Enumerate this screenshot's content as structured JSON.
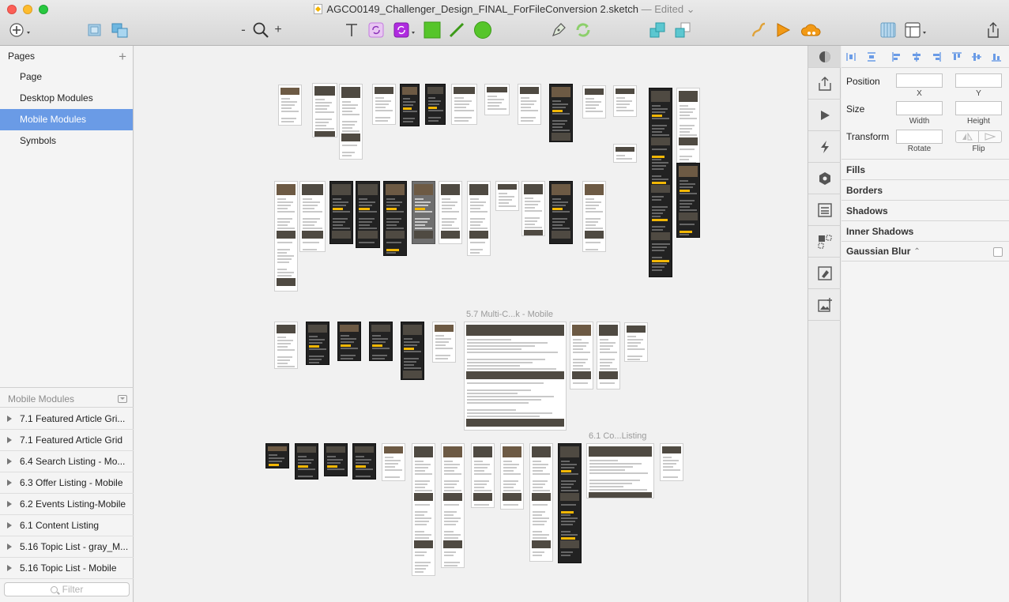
{
  "window": {
    "title": "AGCO0149_Challenger_Design_FINAL_ForFileConversion 2.sketch",
    "status": " — Edited"
  },
  "toolbar": {
    "zoom_minus": "-",
    "zoom_plus": "+"
  },
  "pages": {
    "header": "Pages",
    "add": "+",
    "items": [
      {
        "label": "Page"
      },
      {
        "label": "Desktop Modules"
      },
      {
        "label": "Mobile Modules",
        "selected": true
      },
      {
        "label": "Symbols"
      }
    ]
  },
  "layers": {
    "header": "Mobile Modules",
    "items": [
      {
        "label": "7.1 Featured Article Gri..."
      },
      {
        "label": "7.1 Featured Article Grid"
      },
      {
        "label": "6.4 Search Listing - Mo..."
      },
      {
        "label": "6.3 Offer Listing - Mobile"
      },
      {
        "label": "6.2 Events Listing-Mobile"
      },
      {
        "label": "6.1 Content Listing"
      },
      {
        "label": "5.16 Topic List - gray_M..."
      },
      {
        "label": "5.16 Topic List - Mobile"
      }
    ],
    "filter_placeholder": "Filter"
  },
  "canvas": {
    "labels": {
      "multi": "5.7 Multi-C...k - Mobile",
      "content": "6.1 Co...Listing"
    }
  },
  "inspector": {
    "position": "Position",
    "x": "X",
    "y": "Y",
    "size": "Size",
    "width": "Width",
    "height": "Height",
    "transform": "Transform",
    "rotate": "Rotate",
    "flip": "Flip",
    "sections": [
      "Fills",
      "Borders",
      "Shadows",
      "Inner Shadows",
      "Gaussian Blur"
    ],
    "blur_chevron": "⌃⌄"
  },
  "colors": {
    "selection": "#6a9be6",
    "accent_yellow": "#f2b705",
    "insert_purple": "#b02be0",
    "shape_green": "#56c52a"
  }
}
